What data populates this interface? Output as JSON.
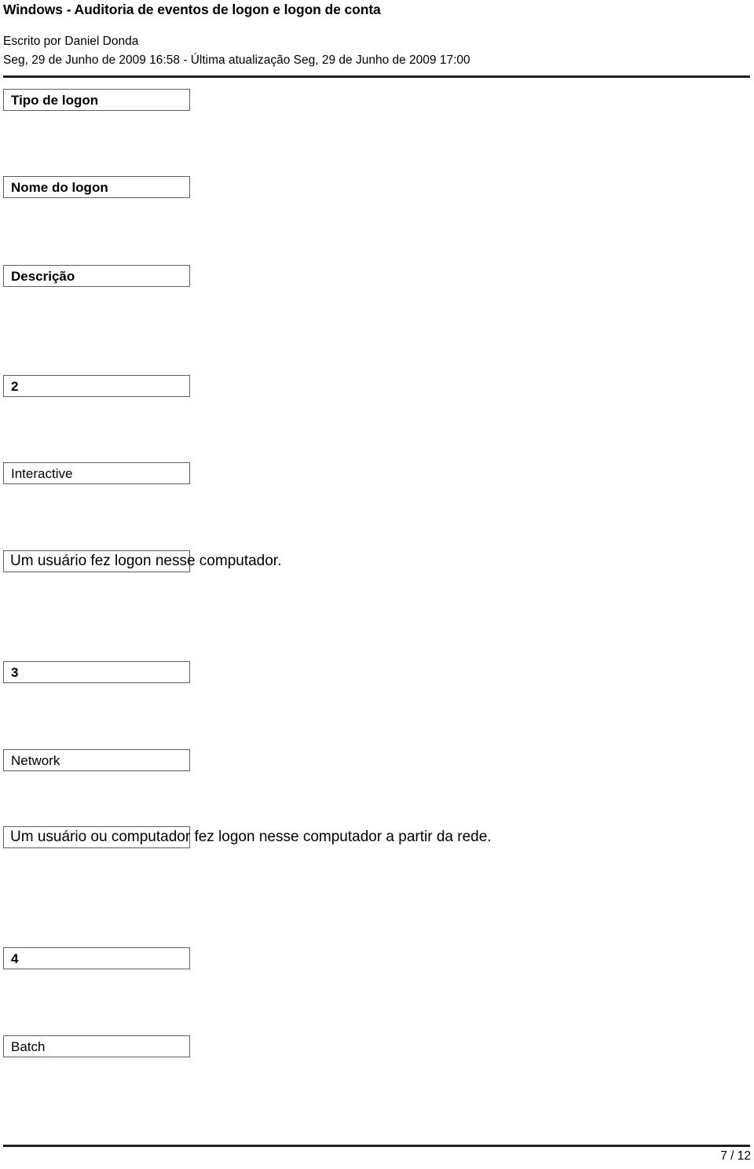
{
  "document": {
    "title": "Windows - Auditoria de eventos de logon e logon de conta",
    "author_line": "Escrito por Daniel Donda",
    "date_line": "Seg, 29 de Junho de 2009 16:58 - Última atualização Seg, 29 de Junho de 2009 17:00"
  },
  "table": {
    "headers": [
      {
        "label": "Tipo de logon"
      },
      {
        "label": "Nome do logon"
      },
      {
        "label": "Descrição"
      }
    ],
    "rows": [
      {
        "type": "2",
        "name": "Interactive",
        "description": "Um usuário fez logon nesse computador."
      },
      {
        "type": "3",
        "name": "Network",
        "description": "Um usuário ou computador fez logon nesse computador a partir da rede."
      },
      {
        "type": "4",
        "name": "Batch",
        "description": ""
      }
    ]
  },
  "footer": {
    "page_label": "7 / 12"
  },
  "colors": {
    "text": "#000000",
    "rule": "#231f20",
    "cell_border": "#5f5f5f",
    "background": "#ffffff"
  }
}
